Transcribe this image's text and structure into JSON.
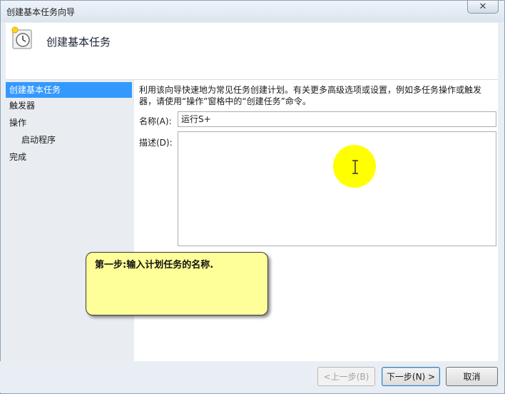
{
  "window": {
    "title": "创建基本任务向导",
    "close_label": "✕"
  },
  "header": {
    "title": "创建基本任务",
    "icon": "clock-task-icon"
  },
  "sidebar": {
    "items": [
      {
        "label": "创建基本任务",
        "active": true
      },
      {
        "label": "触发器",
        "active": false
      },
      {
        "label": "操作",
        "active": false
      },
      {
        "label": "启动程序",
        "active": false,
        "sub": true
      },
      {
        "label": "完成",
        "active": false
      }
    ]
  },
  "form": {
    "intro": "利用该向导快速地为常见任务创建计划。有关更多高级选项或设置，例如多任务操作或触发器，请使用“操作”窗格中的“创建任务”命令。",
    "name_label": "名称(A):",
    "name_value": "运行S+",
    "desc_label": "描述(D):",
    "desc_value": ""
  },
  "callout": {
    "text": "第一步:输入计划任务的名称."
  },
  "buttons": {
    "back": "<上一步(B)",
    "next": "下一步(N) >",
    "cancel": "取消"
  },
  "colors": {
    "selection": "#3399ff",
    "callout_bg": "#ffff99",
    "cursor_highlight": "#ffff00"
  }
}
